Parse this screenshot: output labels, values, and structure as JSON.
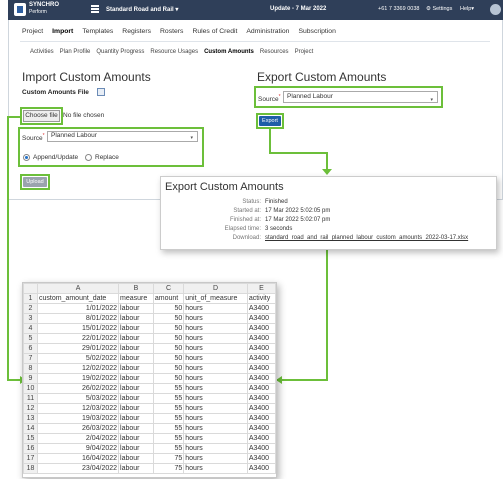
{
  "topbar": {
    "brand": "SYNCHRO",
    "brand_sub": "Perform",
    "project": "Standard Road and Rail ▾",
    "update": "Update - 7 Mar 2022",
    "phone": "+61 7 3369 0038",
    "settings": "⚙ Settings",
    "help": "Help▾"
  },
  "nav_main": [
    "Project",
    "Import",
    "Templates",
    "Registers",
    "Rosters",
    "Rules of Credit",
    "Administration",
    "Subscription"
  ],
  "nav_sub": [
    "Activities",
    "Plan Profile",
    "Quantity Progress",
    "Resource Usages",
    "Custom Amounts",
    "Resources",
    "Project"
  ],
  "import": {
    "title": "Import Custom Amounts",
    "file_label": "Custom Amounts File",
    "choose_file": "Choose file",
    "no_file": "No file chosen",
    "source_label": "Source",
    "source_value": "Planned Labour",
    "append_label": "Append/Update",
    "replace_label": "Replace",
    "upload": "Upload"
  },
  "export": {
    "title": "Export Custom Amounts",
    "source_label": "Source",
    "source_value": "Planned Labour",
    "button": "Export"
  },
  "status_panel": {
    "title": "Export Custom Amounts",
    "rows": [
      {
        "key": "Status:",
        "value": "Finished"
      },
      {
        "key": "Started at:",
        "value": "17 Mar 2022 5:02:05 pm"
      },
      {
        "key": "Finished at:",
        "value": "17 Mar 2022 5:02:07 pm"
      },
      {
        "key": "Elapsed time:",
        "value": "3 seconds"
      },
      {
        "key": "Download:",
        "value": "standard_road_and_rail_planned_labour_custom_amounts_2022-03-17.xlsx"
      }
    ]
  },
  "spreadsheet": {
    "col_letters": [
      "A",
      "B",
      "C",
      "D",
      "E"
    ],
    "headers": [
      "custom_amount_date",
      "measure",
      "amount",
      "unit_of_measure",
      "activity"
    ],
    "rows": [
      [
        "1/01/2022",
        "labour",
        "50",
        "hours",
        "A3400"
      ],
      [
        "8/01/2022",
        "labour",
        "50",
        "hours",
        "A3400"
      ],
      [
        "15/01/2022",
        "labour",
        "50",
        "hours",
        "A3400"
      ],
      [
        "22/01/2022",
        "labour",
        "50",
        "hours",
        "A3400"
      ],
      [
        "29/01/2022",
        "labour",
        "50",
        "hours",
        "A3400"
      ],
      [
        "5/02/2022",
        "labour",
        "50",
        "hours",
        "A3400"
      ],
      [
        "12/02/2022",
        "labour",
        "50",
        "hours",
        "A3400"
      ],
      [
        "19/02/2022",
        "labour",
        "50",
        "hours",
        "A3400"
      ],
      [
        "26/02/2022",
        "labour",
        "55",
        "hours",
        "A3400"
      ],
      [
        "5/03/2022",
        "labour",
        "55",
        "hours",
        "A3400"
      ],
      [
        "12/03/2022",
        "labour",
        "55",
        "hours",
        "A3400"
      ],
      [
        "19/03/2022",
        "labour",
        "55",
        "hours",
        "A3400"
      ],
      [
        "26/03/2022",
        "labour",
        "55",
        "hours",
        "A3400"
      ],
      [
        "2/04/2022",
        "labour",
        "55",
        "hours",
        "A3400"
      ],
      [
        "9/04/2022",
        "labour",
        "55",
        "hours",
        "A3400"
      ],
      [
        "16/04/2022",
        "labour",
        "75",
        "hours",
        "A3400"
      ],
      [
        "23/04/2022",
        "labour",
        "75",
        "hours",
        "A3400"
      ]
    ]
  },
  "colors": {
    "topbar": "#2f3f59",
    "highlight": "#6cbf3a",
    "export_button": "#1e5ea8",
    "upload_button": "#9aa3ad"
  }
}
